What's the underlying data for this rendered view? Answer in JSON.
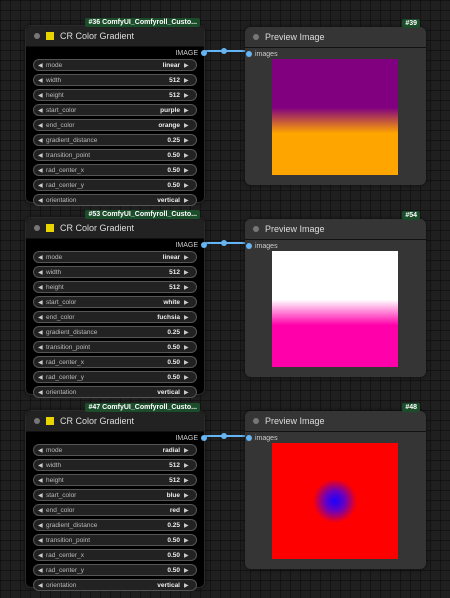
{
  "nodes": [
    {
      "badge": "#36 ComfyUI_Comfyroll_Custo...",
      "title": "CR Color Gradient",
      "output_label": "IMAGE",
      "widgets": [
        {
          "label": "mode",
          "value": "linear"
        },
        {
          "label": "width",
          "value": "512"
        },
        {
          "label": "height",
          "value": "512"
        },
        {
          "label": "start_color",
          "value": "purple"
        },
        {
          "label": "end_color",
          "value": "orange"
        },
        {
          "label": "gradient_distance",
          "value": "0.25"
        },
        {
          "label": "transition_point",
          "value": "0.50"
        },
        {
          "label": "rad_center_x",
          "value": "0.50"
        },
        {
          "label": "rad_center_y",
          "value": "0.50"
        },
        {
          "label": "orientation",
          "value": "vertical"
        }
      ],
      "preview": {
        "badge": "#39",
        "title": "Preview Image",
        "input_label": "images"
      }
    },
    {
      "badge": "#53 ComfyUI_Comfyroll_Custo...",
      "title": "CR Color Gradient",
      "output_label": "IMAGE",
      "widgets": [
        {
          "label": "mode",
          "value": "linear"
        },
        {
          "label": "width",
          "value": "512"
        },
        {
          "label": "height",
          "value": "512"
        },
        {
          "label": "start_color",
          "value": "white"
        },
        {
          "label": "end_color",
          "value": "fuchsia"
        },
        {
          "label": "gradient_distance",
          "value": "0.25"
        },
        {
          "label": "transition_point",
          "value": "0.50"
        },
        {
          "label": "rad_center_x",
          "value": "0.50"
        },
        {
          "label": "rad_center_y",
          "value": "0.50"
        },
        {
          "label": "orientation",
          "value": "vertical"
        }
      ],
      "preview": {
        "badge": "#54",
        "title": "Preview Image",
        "input_label": "images"
      }
    },
    {
      "badge": "#47 ComfyUI_Comfyroll_Custo...",
      "title": "CR Color Gradient",
      "output_label": "IMAGE",
      "widgets": [
        {
          "label": "mode",
          "value": "radial"
        },
        {
          "label": "width",
          "value": "512"
        },
        {
          "label": "height",
          "value": "512"
        },
        {
          "label": "start_color",
          "value": "blue"
        },
        {
          "label": "end_color",
          "value": "red"
        },
        {
          "label": "gradient_distance",
          "value": "0.25"
        },
        {
          "label": "transition_point",
          "value": "0.50"
        },
        {
          "label": "rad_center_x",
          "value": "0.50"
        },
        {
          "label": "rad_center_y",
          "value": "0.50"
        },
        {
          "label": "orientation",
          "value": "vertical"
        }
      ],
      "preview": {
        "badge": "#48",
        "title": "Preview Image",
        "input_label": "images"
      }
    }
  ],
  "colors": {
    "purple": "#800080",
    "orange": "#ffa500",
    "white": "#ffffff",
    "fuchsia": "#ff00aa",
    "blue": "#1a00ff",
    "red": "#ff0000",
    "link": "#64b5f6",
    "badge_bg": "#1b4d2b"
  }
}
